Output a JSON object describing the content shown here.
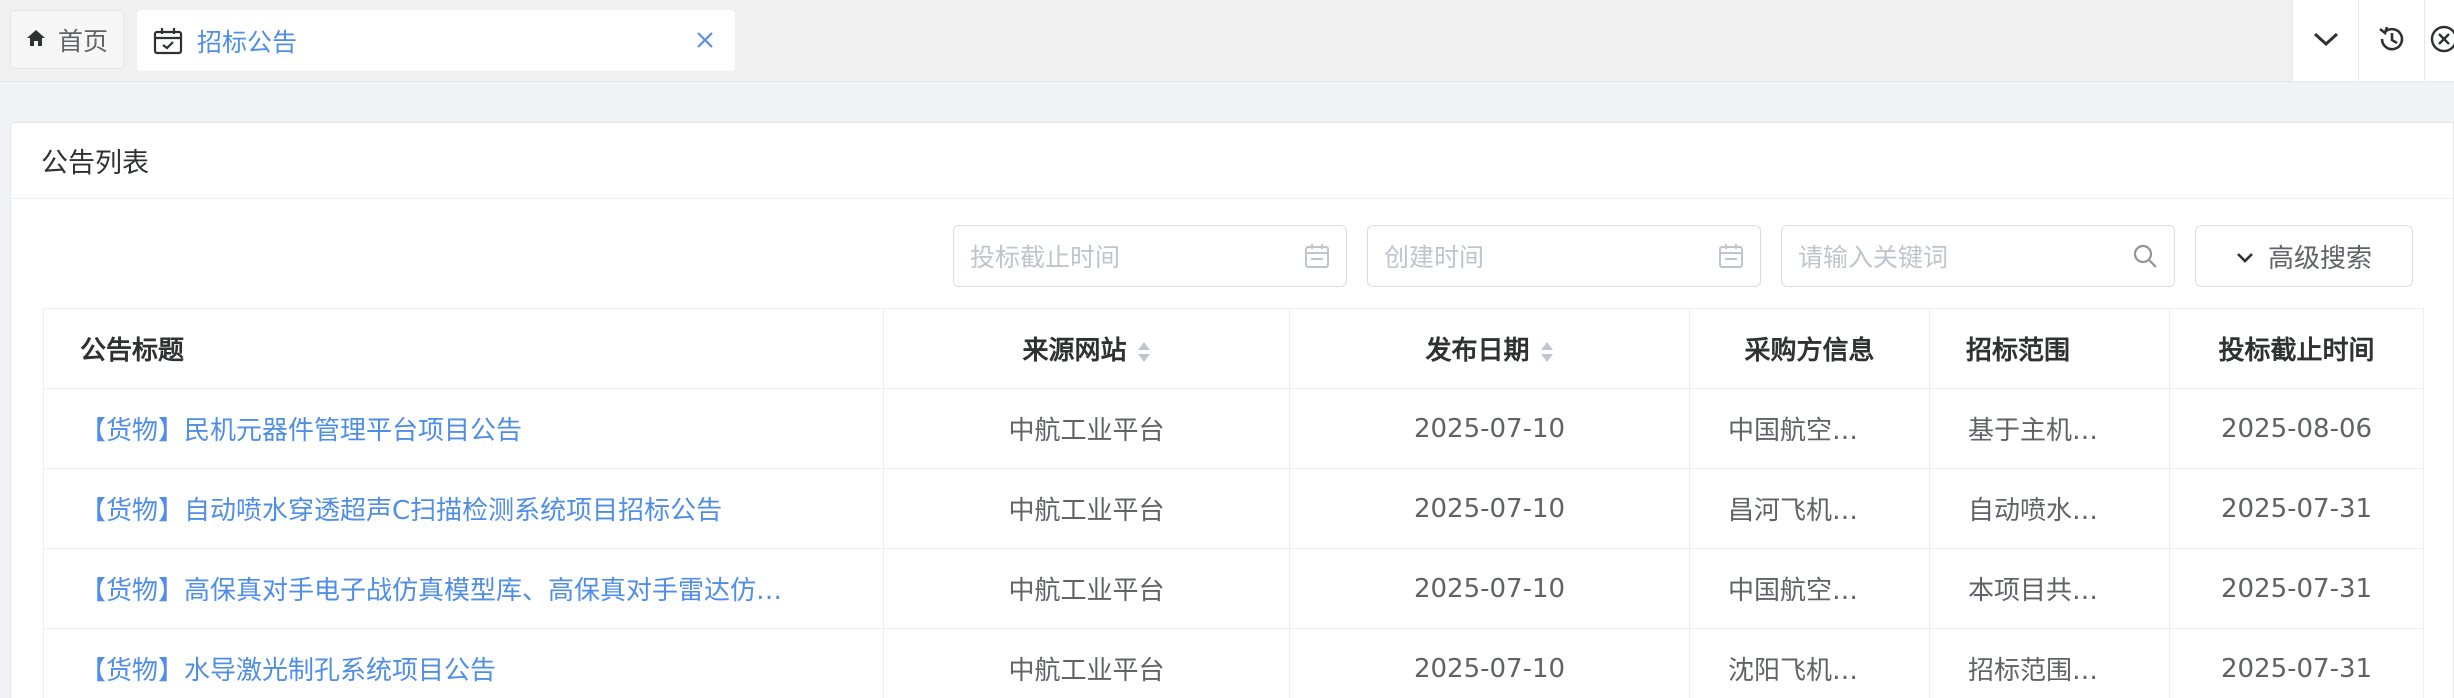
{
  "tabs": {
    "home_label": "首页",
    "active_label": "招标公告"
  },
  "card": {
    "title": "公告列表"
  },
  "filters": {
    "deadline_placeholder": "投标截止时间",
    "created_placeholder": "创建时间",
    "keyword_placeholder": "请输入关键词",
    "advanced_label": "高级搜索"
  },
  "table": {
    "headers": [
      "公告标题",
      "来源网站",
      "发布日期",
      "采购方信息",
      "招标范围",
      "投标截止时间"
    ],
    "rows": [
      {
        "title": "【货物】民机元器件管理平台项目公告",
        "source": "中航工业平台",
        "date": "2025-07-10",
        "buyer": "中国航空…",
        "range": "基于主机…",
        "deadline": "2025-08-06"
      },
      {
        "title": "【货物】自动喷水穿透超声C扫描检测系统项目招标公告",
        "source": "中航工业平台",
        "date": "2025-07-10",
        "buyer": "昌河飞机…",
        "range": "自动喷水…",
        "deadline": "2025-07-31"
      },
      {
        "title": "【货物】高保真对手电子战仿真模型库、高保真对手雷达仿…",
        "source": "中航工业平台",
        "date": "2025-07-10",
        "buyer": "中国航空…",
        "range": "本项目共…",
        "deadline": "2025-07-31"
      },
      {
        "title": "【货物】水导激光制孔系统项目公告",
        "source": "中航工业平台",
        "date": "2025-07-10",
        "buyer": "沈阳飞机…",
        "range": "招标范围…",
        "deadline": "2025-07-31"
      }
    ]
  },
  "colors": {
    "accent": "#4f8ee8",
    "background": "#f0f2f5"
  }
}
